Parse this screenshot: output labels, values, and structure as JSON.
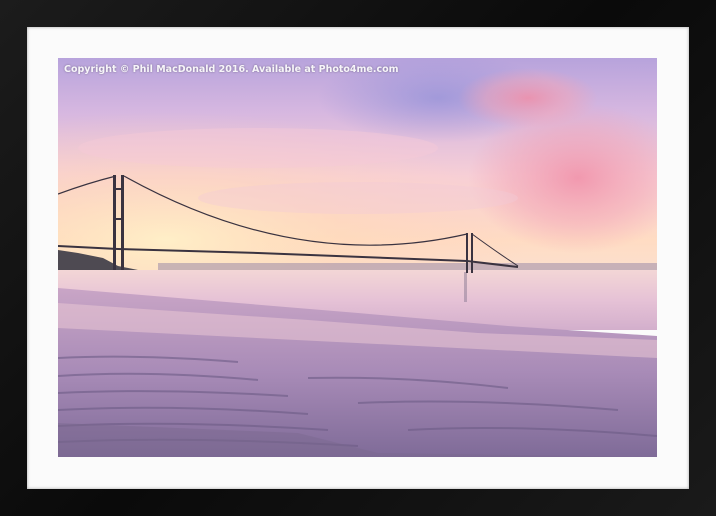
{
  "watermark": {
    "text": "Copyright  © Phil MacDonald  2016. Available at Photo4me.com"
  },
  "colors": {
    "frame": "#111111",
    "mount": "#fbfbfb",
    "sky_top": "#a99ad8",
    "sky_glow": "#ffe2bf",
    "water": "#e4c4d8",
    "sand": "#8c7aa6"
  }
}
